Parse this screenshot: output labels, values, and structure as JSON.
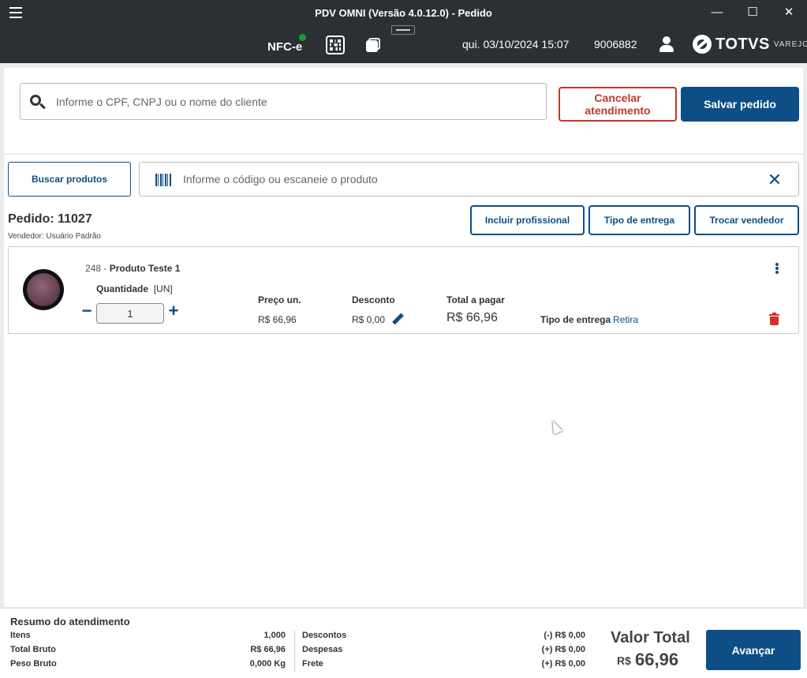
{
  "window": {
    "title": "PDV OMNI (Versão 4.0.12.0) - Pedido",
    "minimize": "—",
    "maximize": "☐",
    "close": "✕"
  },
  "header": {
    "nfce_label": "NFC-e",
    "nfce_status_color": "#1a9a3c",
    "datetime": "qui. 03/10/2024 15:07",
    "terminal_id": "9006882",
    "brand": "TOTVS",
    "brand_sub": "VAREJO"
  },
  "client": {
    "search_placeholder": "Informe o CPF, CNPJ ou o nome do cliente",
    "cancel_label": "Cancelar atendimento",
    "save_label": "Salvar pedido"
  },
  "products": {
    "search_button_label": "Buscar produtos",
    "search_placeholder": "Informe o código ou escaneie o produto",
    "clear_symbol": "✕"
  },
  "order": {
    "title": "Pedido: 11027",
    "seller": "Vendedor: Usuário Padrão",
    "buttons": {
      "professional": "Incluir profissional",
      "delivery_type": "Tipo de entrega",
      "change_seller": "Trocar vendedor"
    }
  },
  "item": {
    "code": "248 - ",
    "name": "Produto Teste 1",
    "qty_label": "Quantidade",
    "qty_unit": "[UN]",
    "qty_value": "1",
    "minus": "−",
    "plus": "+",
    "price_label": "Preço un.",
    "price_value": "R$ 66,96",
    "discount_label": "Desconto",
    "discount_value": "R$ 0,00",
    "total_label": "Total a pagar",
    "total_value": "R$ 66,96",
    "delivery_label": "Tipo de entrega",
    "delivery_value": "Retira"
  },
  "summary": {
    "title": "Resumo do atendimento",
    "items_label": "Itens",
    "items_value": "1,000",
    "gross_total_label": "Total Bruto",
    "gross_total_value": "R$ 66,96",
    "gross_weight_label": "Peso Bruto",
    "gross_weight_value": "0,000 Kg",
    "discounts_label": "Descontos",
    "discounts_value": "(-) R$ 0,00",
    "expenses_label": "Despesas",
    "expenses_value": "(+) R$ 0,00",
    "freight_label": "Frete",
    "freight_value": "(+) R$ 0,00",
    "total_label": "Valor Total",
    "total_currency": "R$",
    "total_value": "66,96",
    "next_label": "Avançar"
  }
}
